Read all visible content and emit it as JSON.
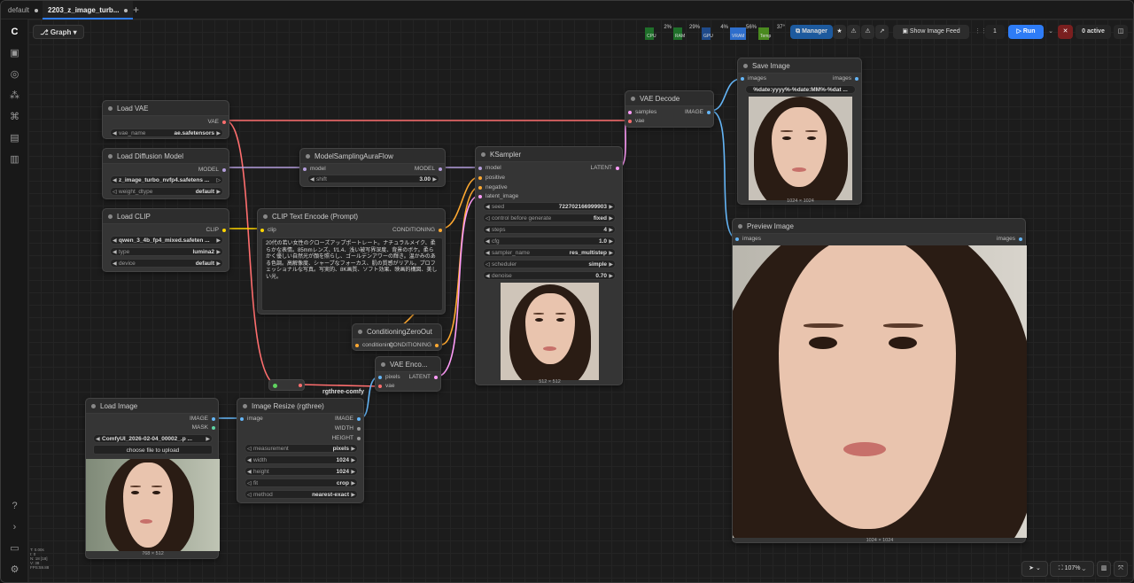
{
  "tabs": [
    {
      "label": "default",
      "active": false
    },
    {
      "label": "2203_z_image_turb...",
      "active": true
    }
  ],
  "toolbar": {
    "graph_label": "Graph",
    "stats": [
      {
        "label": "CPU",
        "value": "2%"
      },
      {
        "label": "RAM",
        "value": "29%"
      },
      {
        "label": "GPU",
        "value": "4%"
      },
      {
        "label": "VRAM",
        "value": "56%"
      },
      {
        "label": "Temp",
        "value": "37°"
      }
    ],
    "manager_label": "Manager",
    "feed_label": "Show Image Feed",
    "queue_count": "1",
    "run_label": "Run",
    "active_label": "0 active"
  },
  "nodes": {
    "load_vae": {
      "title": "Load VAE",
      "out": "VAE",
      "widget_label": "vae_name",
      "widget_value": "ae.safetensors"
    },
    "load_diffusion": {
      "title": "Load Diffusion Model",
      "out": "MODEL",
      "unet_name": "z_image_turbo_nvfp4.safetens ...",
      "weight_label": "weight_dtype",
      "weight_value": "default"
    },
    "load_clip": {
      "title": "Load CLIP",
      "out": "CLIP",
      "clip_name": "qwen_3_4b_fp4_mixed.safeten ...",
      "type_label": "type",
      "type_value": "lumina2",
      "device_label": "device",
      "device_value": "default"
    },
    "model_sampling": {
      "title": "ModelSamplingAuraFlow",
      "in": "model",
      "out": "MODEL",
      "shift_label": "shift",
      "shift_value": "3.00"
    },
    "clip_text": {
      "title": "CLIP Text Encode (Prompt)",
      "in": "clip",
      "out": "CONDITIONING",
      "prompt": "20代の若い女性のクローズアップポートレート。ナチュラルメイク、柔らかな表情。85mmレンズ、f/1.4、浅い被写界深度、背景のボケ。柔らかく優しい自然光が顔を照らし、ゴールデンアワーの輝き。温かみのある色調。高解像度、シャープなフォーカス、肌の質感がリアル。プロフェッショナルな写真。写実的、8K画質、ソフト効果、映画的構図、美しい光。"
    },
    "cond_zero": {
      "title": "ConditioningZeroOut",
      "in": "conditioning",
      "out": "CONDITIONING"
    },
    "ksampler": {
      "title": "KSampler",
      "out": "LATENT",
      "inputs": [
        "model",
        "positive",
        "negative",
        "latent_image"
      ],
      "widgets": [
        {
          "label": "seed",
          "value": "722702166999903"
        },
        {
          "label": "control before generate",
          "value": "fixed"
        },
        {
          "label": "steps",
          "value": "4"
        },
        {
          "label": "cfg",
          "value": "1.0"
        },
        {
          "label": "sampler_name",
          "value": "res_multistep"
        },
        {
          "label": "scheduler",
          "value": "simple"
        },
        {
          "label": "denoise",
          "value": "0.70"
        }
      ],
      "caption": "512 × 512"
    },
    "vae_decode": {
      "title": "VAE Decode",
      "in1": "samples",
      "in2": "vae",
      "out": "IMAGE"
    },
    "vae_encode": {
      "title": "VAE Enco...",
      "in1": "pixels",
      "in2": "vae",
      "out": "LATENT"
    },
    "save_image": {
      "title": "Save Image",
      "in": "images",
      "out": "images",
      "prefix": "%date:yyyy%-%date:MM%-%dat ...",
      "caption": "1024 × 1024"
    },
    "preview_image": {
      "title": "Preview Image",
      "in": "images",
      "out": "images",
      "caption": "1024 × 1024"
    },
    "load_image": {
      "title": "Load Image",
      "out1": "IMAGE",
      "out2": "MASK",
      "file": "ComfyUI_2026-02-04_00002_.p ...",
      "upload": "choose file to upload",
      "caption": "768 × 512"
    },
    "image_resize": {
      "title": "Image Resize (rgthree)",
      "in": "image",
      "outs": [
        "IMAGE",
        "WIDTH",
        "HEIGHT"
      ],
      "widgets": [
        {
          "label": "measurement",
          "value": "pixels"
        },
        {
          "label": "width",
          "value": "1024"
        },
        {
          "label": "height",
          "value": "1024"
        },
        {
          "label": "fit",
          "value": "crop"
        },
        {
          "label": "method",
          "value": "nearest-exact"
        }
      ]
    },
    "rgthree_label": "rgthree-comfy"
  },
  "bottom": {
    "zoom": "107%",
    "stats_lines": [
      "T: 0.00s",
      "I: 0",
      "N: 18 [18]",
      "V: 38",
      "FPS:59.88"
    ]
  },
  "colors": {
    "vae_link": "#ff6e6e",
    "model_link": "#b39ddb",
    "clip_link": "#ffd500",
    "conditioning_link": "#ffa931",
    "latent_link": "#ff9cf9",
    "image_link": "#64b5f6",
    "accent": "#2e7cf6"
  }
}
